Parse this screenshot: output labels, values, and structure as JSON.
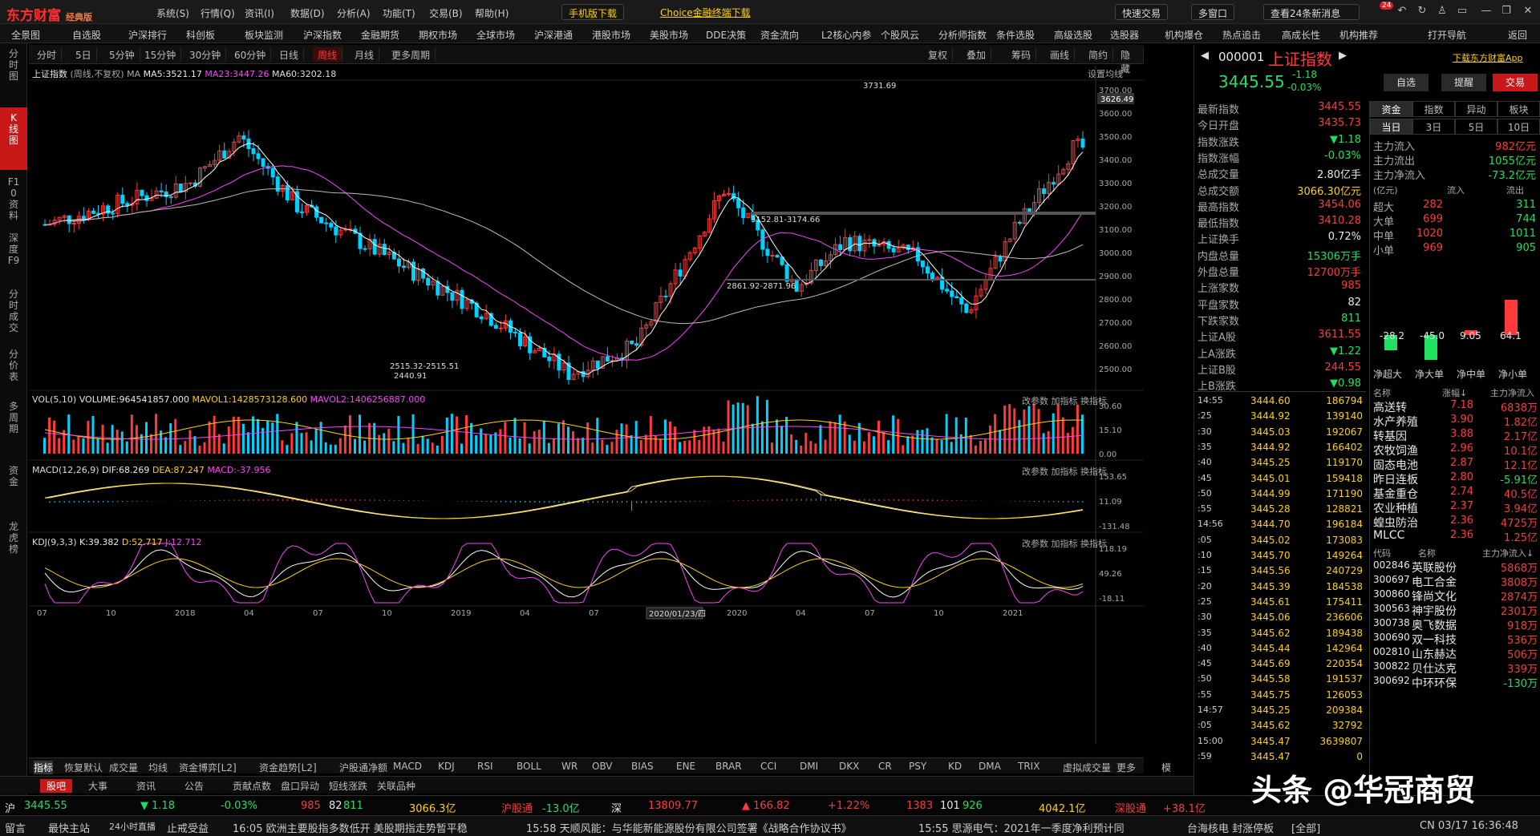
{
  "titlebar": {
    "app_name": "东方财富",
    "edition": "经典版",
    "menus": [
      "系统(S)",
      "行情(Q)",
      "资讯(I)",
      "数据(D)",
      "分析(A)",
      "功能(T)",
      "交易(B)",
      "帮助(H)"
    ],
    "mobile_download": "手机版下载",
    "choice_download": "Choice金融终端下载",
    "quick_trade": "快速交易",
    "multi_window": "多窗口",
    "news": "查看24条新消息",
    "news_badge": "24"
  },
  "nav": [
    "全景图",
    "自选股",
    "沪深排行",
    "科创板",
    "板块监测",
    "沪深指数",
    "金融期货",
    "期权市场",
    "全球市场",
    "沪深港通",
    "港股市场",
    "美股市场",
    "DDE决策",
    "资金流向",
    "L2核心内参",
    "个股风云",
    "分析师指数",
    "条件选股",
    "高级选股",
    "选股器",
    "机构爆仓",
    "热点追击",
    "高成长性",
    "机构推荐",
    "打开导航",
    "返回"
  ],
  "leftbar": [
    "分时图",
    "K线图",
    "F10资料",
    "深度F9",
    "分时成交",
    "分价表",
    "多周期",
    "资金",
    "龙虎榜"
  ],
  "periods": [
    "分时",
    "5日",
    "5分钟",
    "15分钟",
    "30分钟",
    "60分钟",
    "日线",
    "周线",
    "月线",
    "更多周期"
  ],
  "active_period": "周线",
  "tools": [
    "复权",
    "叠加",
    "筹码",
    "画线",
    "简约",
    "隐藏"
  ],
  "chart_header": {
    "name": "上证指数",
    "mode": "(周线,不复权)",
    "settings": "设置均线",
    "ma5": "MA5:3521.17",
    "ma23": "MA23:3447.26",
    "ma60": "MA60:3202.18"
  },
  "annotations": {
    "high": "3731.69",
    "low": "2440.91",
    "band1": "3152.81-3174.66",
    "band2": "2861.92-2871.96",
    "band3": "2515.32-2515.51",
    "last": "3626.49",
    "date_cursor": "2020/01/23/四"
  },
  "vol_header": {
    "label": "VOL(5,10)",
    "vol": "VOLUME:964541857.000",
    "mavol1": "MAVOL1:1428573128.600",
    "mavol2": "MAVOL2:1406256887.000"
  },
  "macd_header": {
    "label": "MACD(12,26,9)",
    "dif": "DIF:68.269",
    "dea": "DEA:87.247",
    "macd": "MACD:-37.956"
  },
  "kdj_header": {
    "label": "KDJ(9,3,3)",
    "k": "K:39.382",
    "d": "D:52.717",
    "j": "J:12.712"
  },
  "panel_tools": [
    "改参数",
    "加指标",
    "换指标"
  ],
  "y_main": [
    "3700.00",
    "3600.00",
    "3500.00",
    "3400.00",
    "3300.00",
    "3200.00",
    "3100.00",
    "3000.00",
    "2900.00",
    "2800.00",
    "2700.00",
    "2600.00",
    "2500.00"
  ],
  "y_vol": [
    "30.60",
    "15.10",
    "0.00"
  ],
  "y_macd": [
    "153.65",
    "11.09",
    "-131.48"
  ],
  "y_kdj": [
    "118.19",
    "49.26",
    "-18.11"
  ],
  "x_labels": [
    "07",
    "10",
    "2018",
    "04",
    "07",
    "10",
    "2019",
    "04",
    "07",
    "10",
    "2020",
    "04",
    "07",
    "10",
    "2021"
  ],
  "indicators": [
    "指标",
    "恢复默认",
    "成交量",
    "均线",
    "资金博弈[L2]",
    "资金趋势[L2]",
    "沪股通净额",
    "MACD",
    "KDJ",
    "RSI",
    "BOLL",
    "WR",
    "OBV",
    "BIAS",
    "ENE",
    "BRAR",
    "CCI",
    "DMI",
    "DKX",
    "CR",
    "PSY",
    "KD",
    "DMA",
    "TRIX",
    "虚拟成交量",
    "更多指标",
    "模板"
  ],
  "bottom_tabs": [
    "股吧",
    "大事",
    "资讯",
    "公告",
    "贡献点数",
    "盘口异动",
    "短线涨跌",
    "关联品种"
  ],
  "quote": {
    "code": "000001",
    "name": "上证指数",
    "price": "3445.55",
    "change": "-1.18",
    "pct": "-0.03%",
    "download": "下载东方财富App",
    "btn_watch": "自选",
    "btn_alert": "提醒",
    "btn_trade": "交易"
  },
  "stats": [
    {
      "label": "最新指数",
      "value": "3445.55",
      "color": "red"
    },
    {
      "label": "今日开盘",
      "value": "3435.73",
      "color": "red"
    },
    {
      "label": "指数涨跌",
      "value": "▼1.18",
      "color": "green"
    },
    {
      "label": "指数涨幅",
      "value": "-0.03%",
      "color": "green"
    },
    {
      "label": "总成交量",
      "value": "2.80亿手",
      "color": "white"
    },
    {
      "label": "总成交额",
      "value": "3066.30亿元",
      "color": "yellow"
    },
    {
      "label": "最高指数",
      "value": "3454.06",
      "color": "red"
    },
    {
      "label": "最低指数",
      "value": "3410.28",
      "color": "red"
    },
    {
      "label": "上证换手",
      "value": "0.72%",
      "color": "white"
    },
    {
      "label": "内盘总量",
      "value": "15306万手",
      "color": "green"
    },
    {
      "label": "外盘总量",
      "value": "12700万手",
      "color": "red"
    },
    {
      "label": "上涨家数",
      "value": "985",
      "color": "red"
    },
    {
      "label": "平盘家数",
      "value": "82",
      "color": "white"
    },
    {
      "label": "下跌家数",
      "value": "811",
      "color": "green"
    },
    {
      "label": "上证A股",
      "value": "3611.55",
      "color": "red"
    },
    {
      "label": "上A涨跌",
      "value": "▼1.22",
      "color": "green"
    },
    {
      "label": "上证B股",
      "value": "244.55",
      "color": "red"
    },
    {
      "label": "上B涨跌",
      "value": "▼0.98",
      "color": "green"
    }
  ],
  "ticks": [
    {
      "t": "14:55",
      "p": "3444.60",
      "v": "186794"
    },
    {
      "t": ":25",
      "p": "3444.92",
      "v": "139140"
    },
    {
      "t": ":30",
      "p": "3445.03",
      "v": "192067"
    },
    {
      "t": ":35",
      "p": "3444.92",
      "v": "166402"
    },
    {
      "t": ":40",
      "p": "3445.25",
      "v": "119170"
    },
    {
      "t": ":45",
      "p": "3445.01",
      "v": "159418"
    },
    {
      "t": ":50",
      "p": "3444.99",
      "v": "171190"
    },
    {
      "t": ":55",
      "p": "3445.28",
      "v": "128821"
    },
    {
      "t": "14:56",
      "p": "3444.70",
      "v": "196184"
    },
    {
      "t": ":05",
      "p": "3445.02",
      "v": "173083"
    },
    {
      "t": ":10",
      "p": "3445.70",
      "v": "149264"
    },
    {
      "t": ":15",
      "p": "3445.56",
      "v": "240729"
    },
    {
      "t": ":20",
      "p": "3445.39",
      "v": "184538"
    },
    {
      "t": ":25",
      "p": "3445.61",
      "v": "175411"
    },
    {
      "t": ":30",
      "p": "3445.06",
      "v": "236606"
    },
    {
      "t": ":35",
      "p": "3445.62",
      "v": "189438"
    },
    {
      "t": ":40",
      "p": "3445.44",
      "v": "142964"
    },
    {
      "t": ":45",
      "p": "3445.69",
      "v": "220354"
    },
    {
      "t": ":50",
      "p": "3445.58",
      "v": "191537"
    },
    {
      "t": ":55",
      "p": "3445.75",
      "v": "126053"
    },
    {
      "t": "14:57",
      "p": "3445.25",
      "v": "209384"
    },
    {
      "t": ":05",
      "p": "3445.62",
      "v": "32792"
    },
    {
      "t": "15:00",
      "p": "3445.47",
      "v": "3639807"
    },
    {
      "t": ":59",
      "p": "3445.47",
      "v": "0"
    }
  ],
  "flow_tabs": [
    "资金",
    "指数",
    "异动",
    "板块"
  ],
  "flow_periods": [
    "当日",
    "3日",
    "5日",
    "10日"
  ],
  "flow": [
    {
      "label": "主力流入",
      "value": "982亿元",
      "color": "red"
    },
    {
      "label": "主力流出",
      "value": "1055亿元",
      "color": "green"
    },
    {
      "label": "主力净流入",
      "value": "-73.2亿元",
      "color": "green"
    }
  ],
  "flow_table": {
    "unit": "(亿元)",
    "in": "流入",
    "out": "流出",
    "rows": [
      {
        "name": "超大",
        "in": "282",
        "out": "311"
      },
      {
        "name": "大单",
        "in": "699",
        "out": "744"
      },
      {
        "name": "中单",
        "in": "1020",
        "out": "1011"
      },
      {
        "name": "小单",
        "in": "969",
        "out": "905"
      }
    ]
  },
  "net_bars": {
    "values": [
      -28.2,
      -45.0,
      9.05,
      64.1
    ],
    "labels": [
      "-28.2",
      "-45.0",
      "9.05",
      "64.1"
    ],
    "names": [
      "净超大",
      "净大单",
      "净中单",
      "净小单"
    ]
  },
  "sector_header": {
    "name": "名称",
    "pct": "涨幅↓",
    "flow": "主力净流入"
  },
  "sectors": [
    {
      "name": "高送转",
      "pct": "7.18",
      "flow": "6838万"
    },
    {
      "name": "水产养殖",
      "pct": "3.90",
      "flow": "1.82亿"
    },
    {
      "name": "转基因",
      "pct": "3.88",
      "flow": "2.17亿"
    },
    {
      "name": "农牧饲渔",
      "pct": "2.96",
      "flow": "10.1亿"
    },
    {
      "name": "固态电池",
      "pct": "2.87",
      "flow": "12.1亿"
    },
    {
      "name": "昨日连板",
      "pct": "2.80",
      "flow": "-5.91亿"
    },
    {
      "name": "基金重仓",
      "pct": "2.74",
      "flow": "40.5亿"
    },
    {
      "name": "农业种植",
      "pct": "2.37",
      "flow": "3.94亿"
    },
    {
      "name": "蝗虫防治",
      "pct": "2.36",
      "flow": "4725万"
    },
    {
      "name": "MLCC",
      "pct": "2.36",
      "flow": "1.25亿"
    }
  ],
  "stock_header": {
    "code": "代码",
    "name": "名称",
    "flow": "主力净流入↓"
  },
  "stocks": [
    {
      "code": "002846",
      "name": "英联股份",
      "flow": "5868万"
    },
    {
      "code": "300697",
      "name": "电工合金",
      "flow": "3808万"
    },
    {
      "code": "300860",
      "name": "锋尚文化",
      "flow": "2874万"
    },
    {
      "code": "300563",
      "name": "神宇股份",
      "flow": "2301万"
    },
    {
      "code": "300738",
      "name": "奥飞数据",
      "flow": "918万"
    },
    {
      "code": "300690",
      "name": "双一科技",
      "flow": "536万"
    },
    {
      "code": "002810",
      "name": "山东赫达",
      "flow": "506万"
    },
    {
      "code": "300822",
      "name": "贝仕达克",
      "flow": "339万"
    },
    {
      "code": "300692",
      "name": "中环环保",
      "flow": "-130万"
    }
  ],
  "status": {
    "market": "沪",
    "price": "3445.55",
    "chg": "▼ 1.18",
    "pct": "-0.03%",
    "up": "985",
    "flat": "82",
    "down": "811",
    "amount": "3066.3亿",
    "hgt_label": "沪股通",
    "hgt": "-13.0亿",
    "sz": "深",
    "sz_price": "13809.77",
    "sz_chg": "▲ 166.82",
    "sz_pct": "+1.22%",
    "sz_up": "1383",
    "sz_flat": "101",
    "sz_down": "926",
    "sz_amount": "4042.1亿",
    "sgt_label": "深股通",
    "sgt": "+38.1亿"
  },
  "ticker": {
    "left": "留言",
    "live": "最快主站",
    "live24": "24小时直播",
    "items": [
      "止戒受益",
      "16:05 欧洲主要股指多数低开 美股期指走势暂平稳",
      "15:58 天顺风能：与华能新能源股份有限公司签署《战略合作协议书》",
      "15:55 思源电气：2021年一季度净利预计同"
    ],
    "right": "台海核电 封涨停板",
    "all": "[全部]",
    "date": "CN 03/17 16:36:48"
  },
  "watermark": "头条 @华冠商贸"
}
